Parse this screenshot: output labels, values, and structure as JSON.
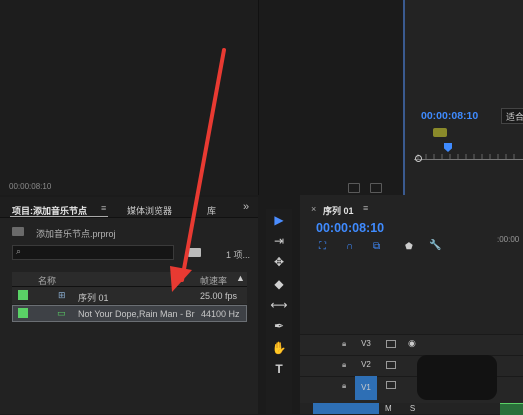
{
  "source_monitor": {
    "timecode": "00:00:08:10"
  },
  "program_monitor": {
    "timecode": "00:00:08:10",
    "fit_label": "适合"
  },
  "project_panel": {
    "tab_project": "项目:添加音乐节点",
    "tab_menu": "≡",
    "tab_media": "媒体浏览器",
    "tab_library": "库",
    "more": "»",
    "file_name": "添加音乐节点.prproj",
    "search_icon": "⌕",
    "item_count": "1 项...",
    "col_name": "名称",
    "col_fps": "帧速率",
    "col_fps_arrow": "▲",
    "rows": [
      {
        "icon": "⊞",
        "name": "序列 01",
        "rate": "25.00 fps",
        "label_color": "#5ad166"
      },
      {
        "icon": "▭",
        "name": "Not Your Dope,Rain Man - Br",
        "rate": "44100 Hz",
        "label_color": "#5ad166"
      }
    ]
  },
  "tools": {
    "select": "▶",
    "track_select": "⇥",
    "ripple": "✥",
    "razor": "◆",
    "slip": "⟷",
    "pen": "✒",
    "hand": "✋",
    "type": "T"
  },
  "timeline": {
    "close": "×",
    "title": "序列 01",
    "menu": "≡",
    "timecode": "00:00:08:10",
    "ruler_tc": ":00:00",
    "tracks": [
      {
        "name": "V3"
      },
      {
        "name": "V2"
      },
      {
        "name": "V1"
      }
    ],
    "bottom_letters": "M S"
  },
  "colors": {
    "accent": "#3f8bff",
    "label_green": "#5ad166",
    "arrow_red": "#e83a32"
  }
}
